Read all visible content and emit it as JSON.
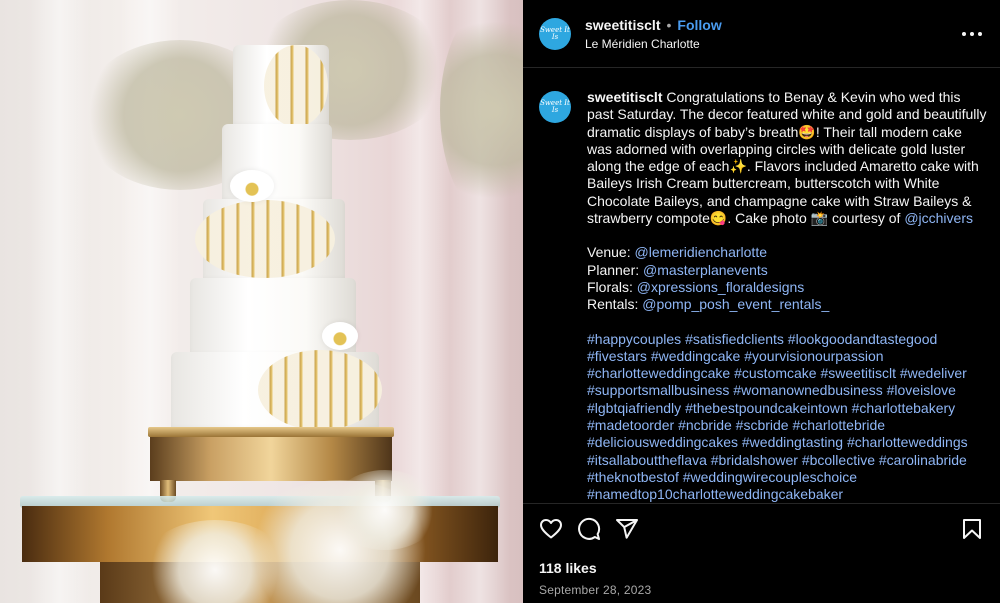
{
  "post": {
    "username": "sweetitisclt",
    "follow_label": "Follow",
    "separator": "•",
    "location": "Le Méridien Charlotte",
    "avatar_text": "Sweet It Is",
    "more_glyph": "•••",
    "caption": {
      "username": "sweetitisclt",
      "text_1": " Congratulations to Benay & Kevin who wed this past Saturday. The decor featured white and gold and beautifully dramatic displays of baby’s breath🤩! Their tall modern cake was adorned with overlapping circles with delicate gold luster along the edge of each✨. Flavors included Amaretto cake with Baileys Irish Cream buttercream, butterscotch with White Chocolate Baileys, and champagne cake with Straw Baileys & strawberry compote😋. Cake photo 📸 courtesy of ",
      "photo_credit": "@jcchivers",
      "credits": [
        {
          "label": "Venue: ",
          "handle": "@lemeridiencharlotte"
        },
        {
          "label": "Planner: ",
          "handle": "@masterplanevents"
        },
        {
          "label": "Florals: ",
          "handle": "@xpressions_floraldesigns"
        },
        {
          "label": "Rentals: ",
          "handle": "@pomp_posh_event_rentals_"
        }
      ],
      "hashtags": [
        "#happycouples",
        "#satisfiedclients",
        "#lookgoodandtastegood",
        "#fivestars",
        "#weddingcake",
        "#yourvisionourpassion",
        "#charlotteweddingcake",
        "#customcake",
        "#sweetitisclt",
        "#wedeliver",
        "#supportsmallbusiness",
        "#womanownedbusiness",
        "#loveislove",
        "#lgbtqiafriendly",
        "#thebestpoundcakeintown",
        "#charlottebakery",
        "#madetoorder",
        "#ncbride",
        "#scbride",
        "#charlottebride",
        "#deliciousweddingcakes",
        "#weddingtasting",
        "#charlotteweddings",
        "#itsallabouttheflava",
        "#bridalshower",
        "#bcollective",
        "#carolinabride",
        "#theknotbestof",
        "#weddingwirecoupleschoice",
        "#namedtop10charlotteweddingcakebaker"
      ]
    },
    "likes": "118 likes",
    "date": "September 28, 2023"
  },
  "colors": {
    "background": "#000000",
    "link": "#8fb6f5",
    "follow": "#4a9cf0",
    "avatar": "#2ea7e0",
    "muted": "#a8a8a8"
  },
  "icons": [
    "heart-icon",
    "comment-icon",
    "share-icon",
    "bookmark-icon",
    "more-icon"
  ]
}
